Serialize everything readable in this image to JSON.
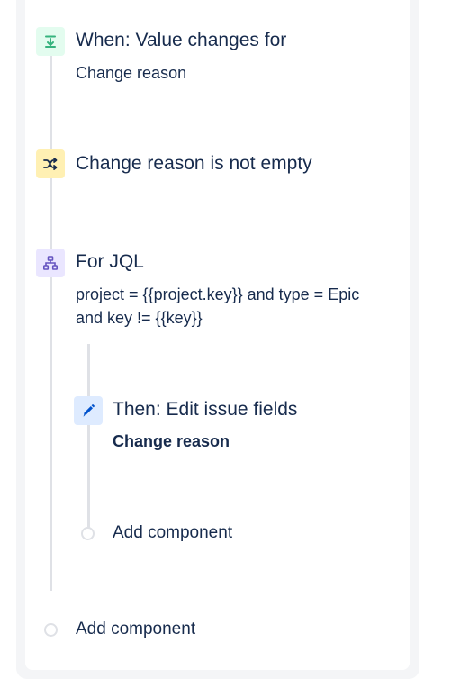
{
  "trigger": {
    "title": "When: Value changes for",
    "detail": "Change reason",
    "icon": "download-arrow-icon",
    "color": "#36b37e",
    "bg": "#e3fcef"
  },
  "condition": {
    "title": "Change reason is not empty",
    "icon": "shuffle-icon",
    "color": "#172b4d",
    "bg": "#fff0b3"
  },
  "branch": {
    "title": "For JQL",
    "detail": "project = {{project.key}} and type = Epic and key != {{key}}",
    "icon": "hierarchy-icon",
    "color": "#6554c0",
    "bg": "#eae6ff"
  },
  "action": {
    "title": "Then: Edit issue fields",
    "detail": "Change reason",
    "icon": "pencil-icon",
    "color": "#0052cc",
    "bg": "#deebff"
  },
  "inner_add_label": "Add component",
  "outer_add_label": "Add component"
}
